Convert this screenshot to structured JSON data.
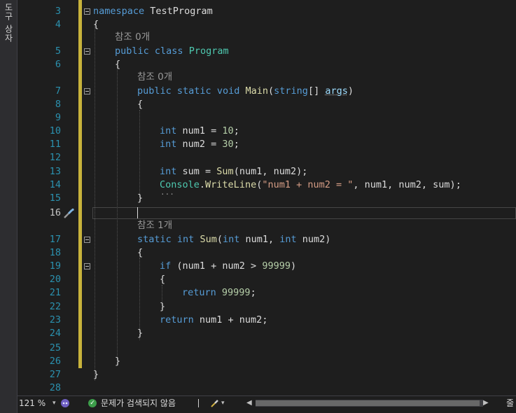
{
  "side_panel": {
    "label": "도구 상자"
  },
  "editor": {
    "lines": [
      {
        "number": "3",
        "code": "namespace TestProgram"
      },
      {
        "number": "4",
        "code": "{"
      },
      {
        "number": "5",
        "code": "public class Program",
        "lens": "참조 0개"
      },
      {
        "number": "6",
        "code": "{"
      },
      {
        "number": "7",
        "code": "public static void Main(string[] args)",
        "lens": "참조 0개"
      },
      {
        "number": "8",
        "code": "{"
      },
      {
        "number": "9",
        "code": ""
      },
      {
        "number": "10",
        "code": "int num1 = 10;"
      },
      {
        "number": "11",
        "code": "int num2 = 30;"
      },
      {
        "number": "12",
        "code": ""
      },
      {
        "number": "13",
        "code": "int sum = Sum(num1, num2);"
      },
      {
        "number": "14",
        "code": "Console.WriteLine(\"num1 + num2 = \", num1, num2, sum);"
      },
      {
        "number": "15",
        "code": "}"
      },
      {
        "number": "16",
        "code": ""
      },
      {
        "number": "17",
        "code": "static int Sum(int num1, int num2)",
        "lens": "참조 1개"
      },
      {
        "number": "18",
        "code": "{"
      },
      {
        "number": "19",
        "code": "if (num1 + num2 > 99999)"
      },
      {
        "number": "20",
        "code": "{"
      },
      {
        "number": "21",
        "code": "return 99999;"
      },
      {
        "number": "22",
        "code": "}"
      },
      {
        "number": "23",
        "code": "return num1 + num2;"
      },
      {
        "number": "24",
        "code": "}"
      },
      {
        "number": "25",
        "code": ""
      },
      {
        "number": "26",
        "code": "}"
      },
      {
        "number": "27",
        "code": "}"
      },
      {
        "number": "28",
        "code": ""
      }
    ]
  },
  "statusbar": {
    "zoom": "121 %",
    "issues_text": "문제가 검색되지 않음",
    "right_label": "줄"
  },
  "colors": {
    "keyword": "#569cd6",
    "type": "#4ec9b0",
    "method": "#dcdcaa",
    "number": "#b5cea8",
    "string": "#d69d85",
    "change_bar": "#c8b33c",
    "line_number": "#2b91af"
  }
}
